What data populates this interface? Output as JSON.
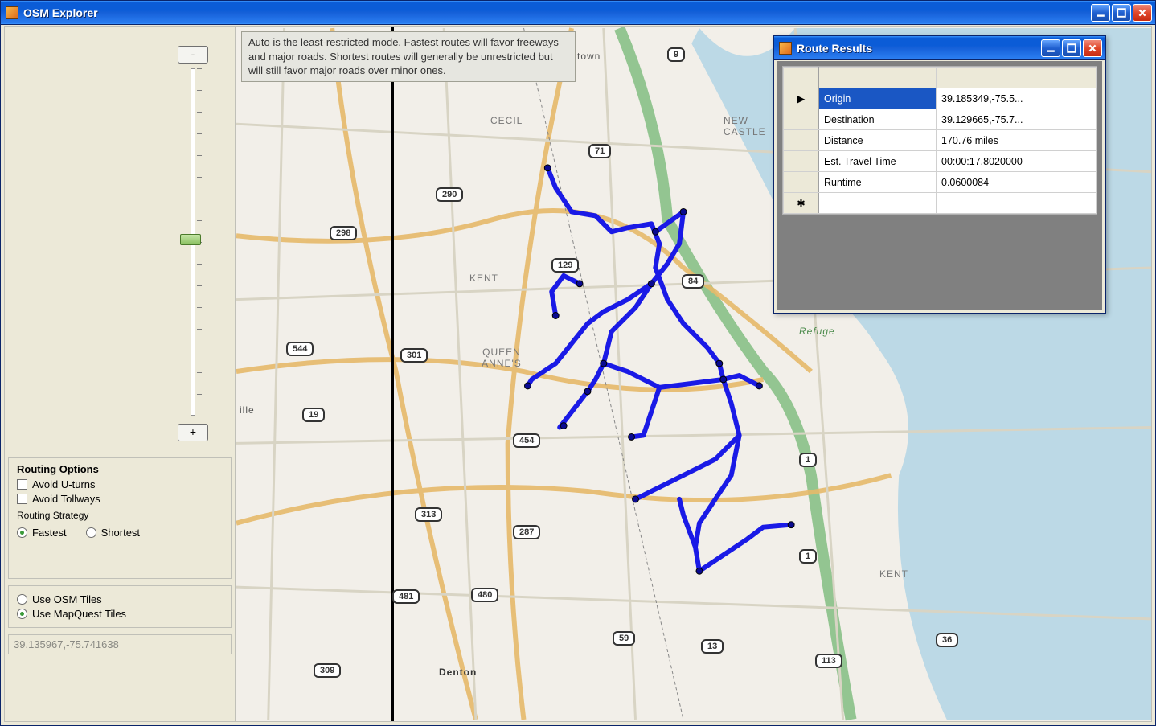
{
  "main_window": {
    "title": "OSM Explorer"
  },
  "zoom": {
    "minus": "-",
    "plus": "+"
  },
  "routing_options": {
    "title": "Routing Options",
    "avoid_uturns": "Avoid U-turns",
    "avoid_tollways": "Avoid Tollways",
    "strategy_label": "Routing Strategy",
    "fastest": "Fastest",
    "shortest": "Shortest"
  },
  "tiles": {
    "use_osm": "Use OSM Tiles",
    "use_mapquest": "Use MapQuest Tiles"
  },
  "coord_status": "39.135967,-75.741638",
  "tooltip": "Auto is the least-restricted mode. Fastest routes will favor freeways and major roads. Shortest routes will generally be unrestricted but will still favor major roads over minor ones.",
  "map_labels": {
    "cecil": "CECIL",
    "kent": "KENT",
    "queen_annes": "QUEEN ANNE'S",
    "new_castle": "NEW CASTLE",
    "kent2": "KENT",
    "refuge": "Refuge",
    "denton": "Denton",
    "ville": "ille",
    "town": "town"
  },
  "shields": {
    "s9": "9",
    "s71": "71",
    "s290": "290",
    "s298": "298",
    "s544": "544",
    "s301": "301",
    "s129": "129",
    "s84": "84",
    "s19": "19",
    "s454": "454",
    "s313": "313",
    "s287": "287",
    "s481": "481",
    "s480": "480",
    "s59": "59",
    "s309": "309",
    "s113": "113",
    "s1a": "1",
    "s1b": "1",
    "s13": "13",
    "s36": "36"
  },
  "results_window": {
    "title": "Route Results"
  },
  "results": {
    "rows": [
      {
        "key": "Origin",
        "value": "39.185349,-75.5..."
      },
      {
        "key": "Destination",
        "value": "39.129665,-75.7..."
      },
      {
        "key": "Distance",
        "value": "170.76 miles"
      },
      {
        "key": "Est. Travel Time",
        "value": "00:00:17.8020000"
      },
      {
        "key": "Runtime",
        "value": "0.0600084"
      }
    ]
  }
}
